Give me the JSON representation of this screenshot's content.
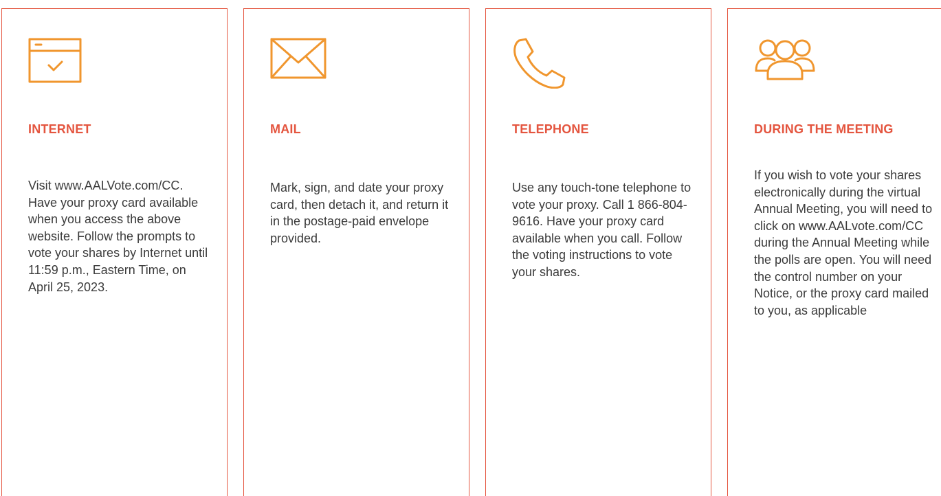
{
  "colors": {
    "accent": "#e4553f",
    "icon": "#f0962e",
    "text": "#3b3b3b"
  },
  "cards": [
    {
      "icon": "browser-check-icon",
      "title": "INTERNET",
      "body": "Visit www.AALVote.com/CC. Have your proxy card available when you access the above website. Follow the prompts to vote your shares by Internet until 11:59 p.m., Eastern Time, on April 25, 2023."
    },
    {
      "icon": "envelope-icon",
      "title": "MAIL",
      "body": "Mark, sign, and date your proxy card, then detach it, and return it in the postage-paid envelope provided."
    },
    {
      "icon": "telephone-icon",
      "title": "TELEPHONE",
      "body": "Use any touch-tone telephone to vote your proxy. Call 1 866-804-9616. Have your proxy card available when you call. Follow the voting instructions to vote your shares."
    },
    {
      "icon": "people-group-icon",
      "title": "DURING THE MEETING",
      "body": "If you wish to vote your shares electronically during the virtual Annual Meeting, you will need to click on www.AALvote.com/CC during the Annual Meeting while the polls are open. You will need the control number on your Notice, or the proxy card mailed to you, as applicable"
    }
  ]
}
